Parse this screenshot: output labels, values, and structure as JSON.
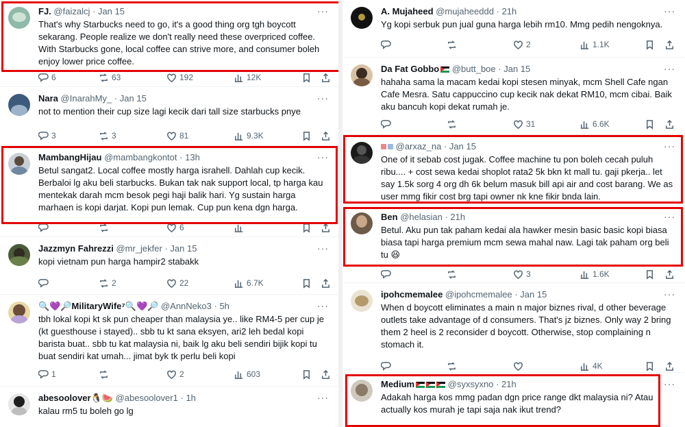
{
  "left_tweets": [
    {
      "name": "FJ.",
      "handle": "@faizalcj",
      "sep": "·",
      "time": "Jan 15",
      "text": "That's why Starbucks need to go, it's a good thing org tgh boycott sekarang. People realize we don't really need these overpriced coffee. With Starbucks gone, local coffee can strive more, and consumer boleh enjoy lower price coffee.",
      "replies": "6",
      "reposts": "63",
      "likes": "192",
      "views": "12K"
    },
    {
      "name": "Nara",
      "handle": "@InarahMy_",
      "sep": "·",
      "time": "Jan 15",
      "text": "not to mention their cup size lagi kecik dari tall size starbucks pnye",
      "replies": "3",
      "reposts": "3",
      "likes": "81",
      "views": "9.3K"
    },
    {
      "name": "MambangHijau",
      "handle": "@mambangkontot",
      "sep": "·",
      "time": "13h",
      "text": "Betul sangat2. Local coffee mostly  harga israhell. Dahlah cup kecik. Berbaloi lg aku beli starbucks. Bukan tak nak support local, tp harga kau mentekak darah mcm besok pegi haji balik hari. Yg sustain harga marhaen is kopi darjat. Kopi pun lemak. Cup pun kena dgn harga.",
      "replies": "",
      "reposts": "",
      "likes": "6",
      "views": ""
    },
    {
      "name": "Jazzmyn Fahrezzi",
      "handle": "@mr_jekfer",
      "sep": "·",
      "time": "Jan 15",
      "text": "kopi vietnam pun harga hampir2 stabakk",
      "replies": "",
      "reposts": "2",
      "likes": "22",
      "views": "6.7K"
    },
    {
      "name": "🔍💜🔎MilitaryWife⁷🔍💜🔎",
      "handle": "@AnnNeko3",
      "sep": "·",
      "time": "5h",
      "text": "tbh lokal kopi kt sk pun cheaper than malaysia ye.. like RM4-5 per cup je (kt guesthouse i stayed).. sbb tu kt sana eksyen, ari2 leh bedal kopi barista buat.. sbb tu kat malaysia ni, baik lg aku beli sendiri bijik kopi tu buat sendiri kat umah... jimat byk tk perlu beli kopi",
      "replies": "1",
      "reposts": "",
      "likes": "2",
      "views": "603"
    },
    {
      "name": "abesoolover🐧🍉",
      "handle": "@abesoolover1",
      "sep": "·",
      "time": "1h",
      "text": "kalau rm5 tu boleh go lg",
      "replies": "",
      "reposts": "",
      "likes": "",
      "views": ""
    }
  ],
  "right_tweets": [
    {
      "name": "A. Mujaheed",
      "handle": "@mujaheeddd",
      "sep": "·",
      "time": "21h",
      "text": "Yg kopi serbuk pun jual guna harga lebih rm10. Mmg pedih nengoknya.",
      "replies": "",
      "reposts": "",
      "likes": "2",
      "views": "1.1K"
    },
    {
      "name": "Da Fat Gobbo",
      "handle": "@butt_boe",
      "sep": "·",
      "time": "Jan 15",
      "text": "hahaha sama la macam kedai kopi stesen minyak, mcm Shell Cafe ngan Cafe Mesra. Satu cappuccino cup kecik nak dekat RM10, mcm cibai. Baik aku bancuh kopi dekat rumah je.",
      "replies": "",
      "reposts": "",
      "likes": "31",
      "views": "6.6K"
    },
    {
      "name": "",
      "handle": "@arxaz_na",
      "sep": "·",
      "time": "Jan 15",
      "text": "One of it sebab cost jugak. Coffee machine tu pon  boleh cecah puluh ribu.... + cost sewa kedai shoplot rata2 5k bkn kt mall tu. gaji pkerja.. let say 1.5k sorg 4 org dh 6k belum masuk bill api air and cost barang. We as user mmg fikir cost brg tapi owner nk kne fikir bnda lain.",
      "replies": "",
      "reposts": "",
      "likes": "",
      "views": ""
    },
    {
      "name": "Ben",
      "handle": "@helasian",
      "sep": "·",
      "time": "21h",
      "text": "Betul. Aku pun tak paham kedai ala hawker mesin basic basic kopi biasa biasa tapi harga premium mcm sewa mahal naw. Lagi tak paham org beli tu 😆",
      "replies": "",
      "reposts": "",
      "likes": "3",
      "views": "1.6K"
    },
    {
      "name": "ipohcmemalee",
      "handle": "@ipohcmemalee",
      "sep": "·",
      "time": "Jan 15",
      "text": "When d boycott eliminates a main n major biznes rival, d other beverage outlets take advantage of d consumers. That's jz biznes. Only way 2 bring them 2 heel is 2 reconsider d boycott. Otherwise, stop complaining n stomach it.",
      "replies": "",
      "reposts": "",
      "likes": "",
      "views": "4K"
    },
    {
      "name": "Medium",
      "handle": "@syxsyxno",
      "sep": "·",
      "time": "21h",
      "text": "Adakah harga kos mmg padan dgn price range dkt malaysia ni? Atau actually kos murah je tapi saja nak ikut trend?",
      "replies": "",
      "reposts": "",
      "likes": "",
      "views": ""
    }
  ],
  "more_glyph": "···",
  "icons": [
    "reply-icon",
    "repost-icon",
    "like-icon",
    "views-icon",
    "bookmark-icon",
    "share-icon",
    "more-icon"
  ],
  "colors": {
    "highlight": "#e50000",
    "meta_text": "#536471",
    "text": "#0f1419"
  }
}
